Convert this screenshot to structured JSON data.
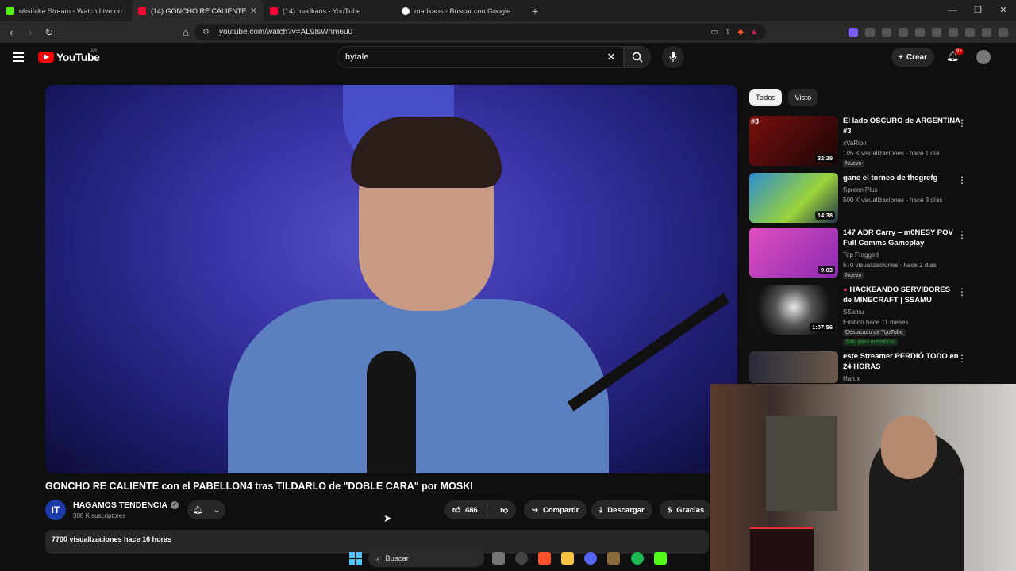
{
  "browser": {
    "tabs": [
      {
        "label": "ohsifake Stream - Watch Live on",
        "favicon_color": "#53fc18"
      },
      {
        "label": "(14) GONCHO RE CALIENTE con",
        "favicon_color": "#ff0033"
      },
      {
        "label": "(14) madkaos - YouTube",
        "favicon_color": "#ff0033"
      },
      {
        "label": "madkaos - Buscar con Google",
        "favicon_color": "#ffffff"
      }
    ],
    "url": "youtube.com/watch?v=AL9IsWnm6u0"
  },
  "youtube": {
    "logo_text": "YouTube",
    "country": "AR",
    "search_value": "hytale",
    "create_label": "Crear",
    "notif_badge": "9+"
  },
  "video": {
    "title": "GONCHO RE CALIENTE con el PABELLON4 tras TILDARLO de \"DOBLE CARA\" por MOSKI",
    "channel": "HAGAMOS TENDENCIA",
    "channel_initials": "IT",
    "subscribers": "308 K suscriptores",
    "likes": "486",
    "share_label": "Compartir",
    "download_label": "Descargar",
    "thanks_label": "Gracias",
    "views_line": "7700 visualizaciones  hace 16 horas"
  },
  "sidebar": {
    "chips": [
      "Todos",
      "Visto"
    ],
    "recs": [
      {
        "rank": "#3",
        "title": "El lado OSCURO de ARGENTINA #3",
        "channel": "xVaRion",
        "meta": "105 K visualizaciones · hace 1 día",
        "badge": "Nuevo",
        "duration": "32:29",
        "thumb_color": "#5a0c0c"
      },
      {
        "rank": "",
        "title": "gane el torneo de thegrefg",
        "channel": "Spreen Plus",
        "meta": "500 K visualizaciones · hace 8 días",
        "badge": "",
        "duration": "14:38",
        "thumb_color": "#3a6f9a"
      },
      {
        "rank": "",
        "title": "147 ADR Carry – m0NESY POV Full Comms Gameplay",
        "channel": "Top Fragged",
        "meta": "670 visualizaciones · hace 2 días",
        "badge": "Nuevo",
        "duration": "9:03",
        "thumb_color": "#c13aa0"
      },
      {
        "rank": "",
        "title": "HACKEANDO SERVIDORES de MINECRAFT | SSAMU",
        "channel": "SSamu",
        "meta": "Emitido hace 11 meses",
        "badge": "Destacado de YouTube",
        "members": "Solo para miembros",
        "duration": "1:07:56",
        "thumb_color": "#1a1a1a"
      },
      {
        "rank": "",
        "title": "este Streamer PERDIÓ TODO en 24 HORAS",
        "channel": "Harux",
        "meta": "",
        "badge": "",
        "duration": "",
        "thumb_color": "#2a3a5a"
      }
    ]
  },
  "taskbar": {
    "search_label": "Buscar"
  }
}
